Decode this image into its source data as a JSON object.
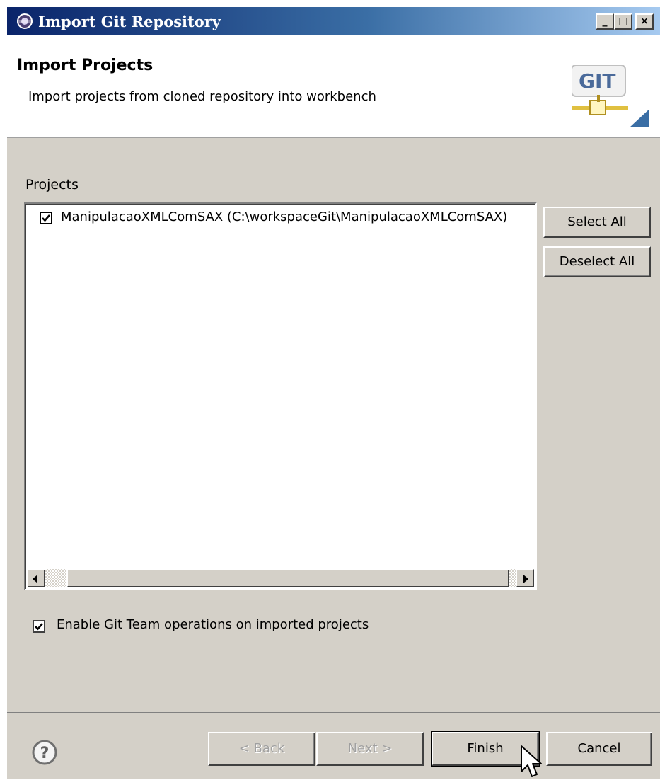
{
  "window": {
    "title": "Import Git Repository",
    "minimize_glyph": "_",
    "maximize_glyph": "□",
    "close_glyph": "×"
  },
  "header": {
    "title": "Import Projects",
    "description": "Import projects from cloned repository into workbench",
    "logo_text": "GIT"
  },
  "projects": {
    "label": "Projects",
    "items": [
      {
        "label": "ManipulacaoXMLComSAX (C:\\workspaceGit\\ManipulacaoXMLComSAX)",
        "checked": true
      }
    ],
    "select_all_label": "Select All",
    "deselect_all_label": "Deselect All"
  },
  "options": {
    "enable_git_label": "Enable Git Team operations on imported projects",
    "enable_git_checked": true
  },
  "footer": {
    "help_icon": "help-icon",
    "back_label": "< Back",
    "next_label": "Next >",
    "finish_label": "Finish",
    "cancel_label": "Cancel"
  },
  "colors": {
    "title_gradient_start": "#0a246a",
    "title_gradient_end": "#a6caf0",
    "dialog_face": "#d4d0c8",
    "disabled_text": "#a0a0a0"
  }
}
